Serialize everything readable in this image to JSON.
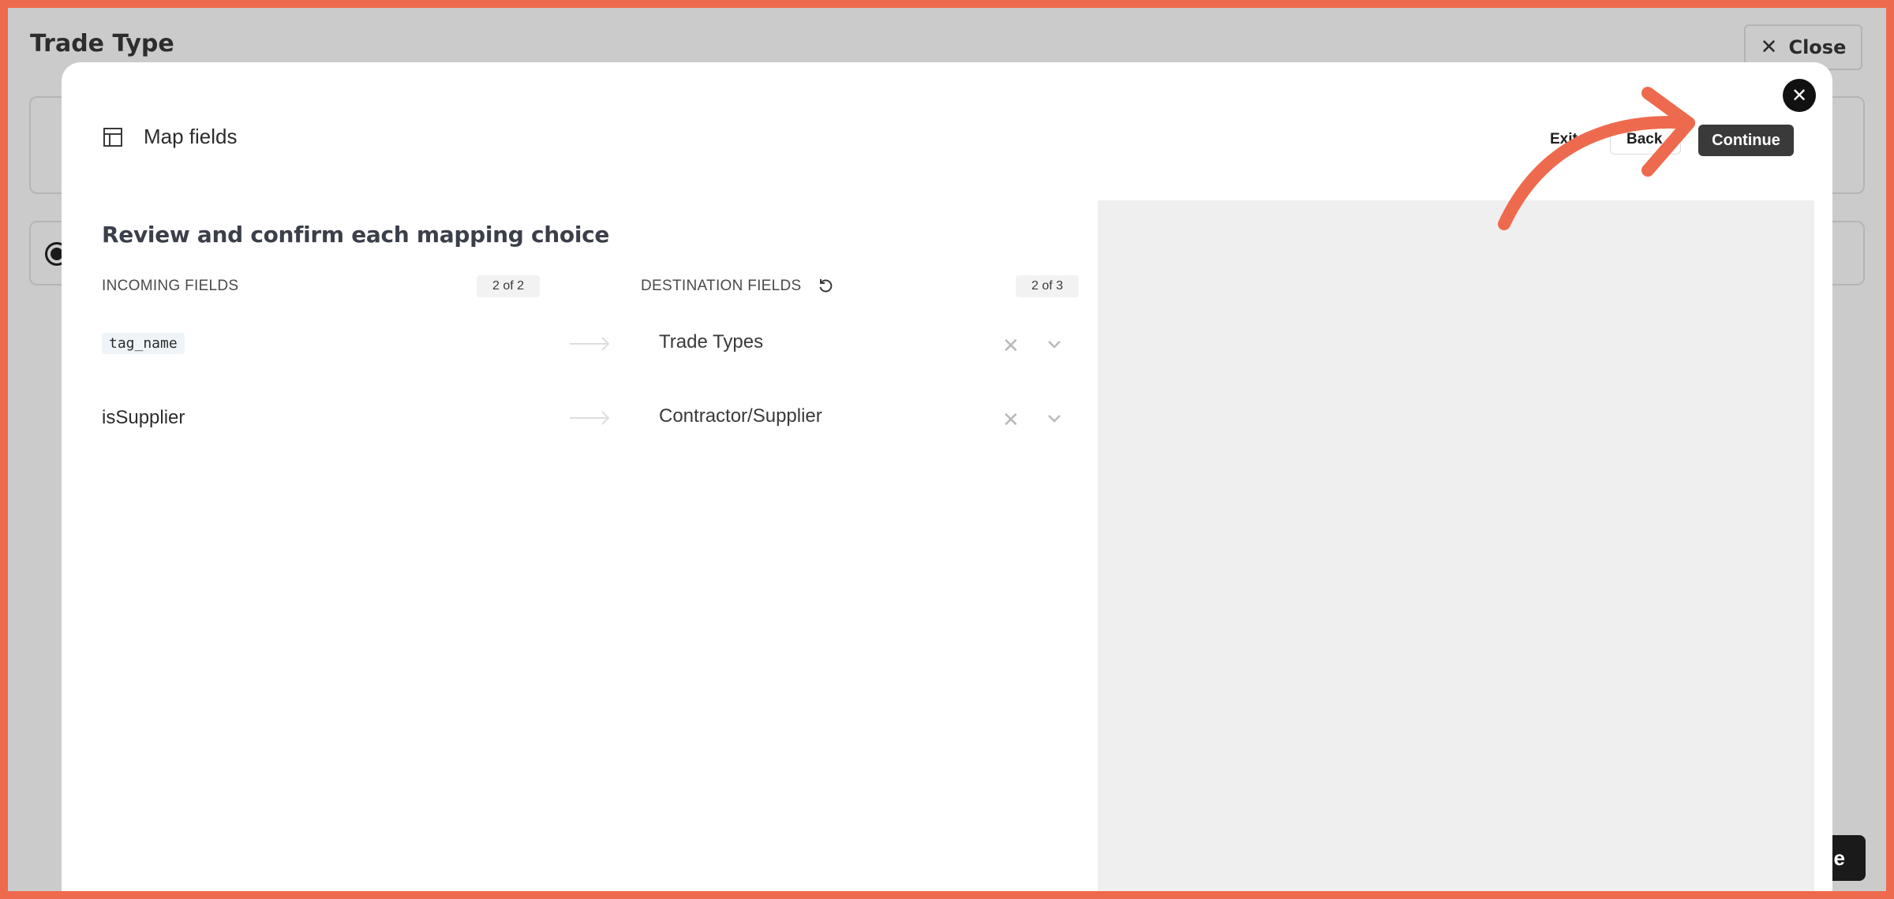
{
  "background": {
    "title": "Trade Type",
    "close_label": "Close",
    "save_label_partial": "e"
  },
  "modal": {
    "title": "Map fields",
    "exit_label": "Exit",
    "back_label": "Back",
    "continue_label": "Continue",
    "heading": "Review and confirm each mapping choice",
    "incoming_header": "INCOMING FIELDS",
    "incoming_count": "2 of 2",
    "destination_header": "DESTINATION FIELDS",
    "destination_count": "2 of 3",
    "mappings": [
      {
        "source": "tag_name",
        "destination": "Trade Types"
      },
      {
        "source": "isSupplier",
        "destination": "Contractor/Supplier"
      }
    ]
  },
  "colors": {
    "annotation": "#ee6a4e",
    "continue_bg": "#3a3a3a",
    "preview_bg": "#efefef"
  },
  "icons": [
    "close-icon",
    "table-icon",
    "reset-icon",
    "arrow-right-icon",
    "clear-icon",
    "chevron-down-icon"
  ]
}
